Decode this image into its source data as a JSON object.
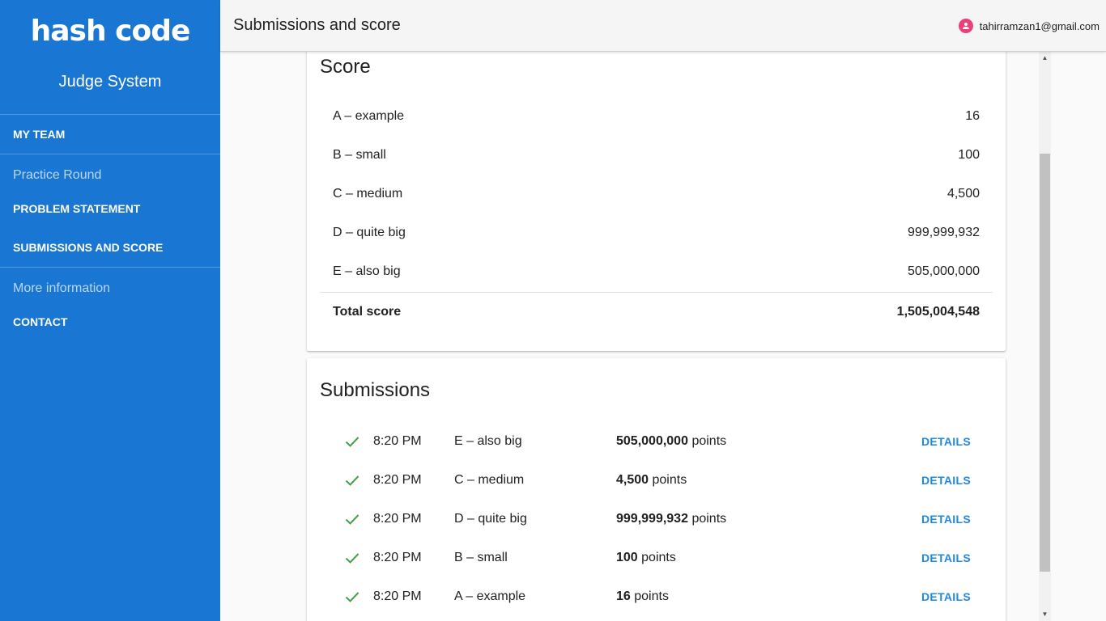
{
  "sidebar": {
    "logo": "hash code",
    "subtitle": "Judge System",
    "my_team": "MY TEAM",
    "practice_round": "Practice Round",
    "problem_statement": "PROBLEM STATEMENT",
    "submissions_and_score": "SUBMISSIONS AND SCORE",
    "more_information": "More information",
    "contact": "CONTACT"
  },
  "header": {
    "title": "Submissions and score",
    "user_email": "tahirramzan1@gmail.com"
  },
  "score": {
    "title": "Score",
    "rows": [
      {
        "label": "A – example",
        "value": "16"
      },
      {
        "label": "B – small",
        "value": "100"
      },
      {
        "label": "C – medium",
        "value": "4,500"
      },
      {
        "label": "D – quite big",
        "value": "999,999,932"
      },
      {
        "label": "E – also big",
        "value": "505,000,000"
      }
    ],
    "total_label": "Total score",
    "total_value": "1,505,004,548"
  },
  "submissions": {
    "title": "Submissions",
    "points_suffix": "points",
    "details_label": "DETAILS",
    "rows": [
      {
        "time": "8:20 PM",
        "dataset": "E – also big",
        "points": "505,000,000"
      },
      {
        "time": "8:20 PM",
        "dataset": "C – medium",
        "points": "4,500"
      },
      {
        "time": "8:20 PM",
        "dataset": "D – quite big",
        "points": "999,999,932"
      },
      {
        "time": "8:20 PM",
        "dataset": "B – small",
        "points": "100"
      },
      {
        "time": "8:20 PM",
        "dataset": "A – example",
        "points": "16"
      }
    ]
  },
  "colors": {
    "sidebar_bg": "#1976d2",
    "accent_link": "#1e88e5",
    "success_check": "#43a047",
    "avatar": "#ec407a"
  },
  "icons": {
    "status": "check-icon",
    "user": "account-circle-icon",
    "scroll_up": "scroll-up-arrow-icon",
    "scroll_down": "scroll-down-arrow-icon"
  }
}
